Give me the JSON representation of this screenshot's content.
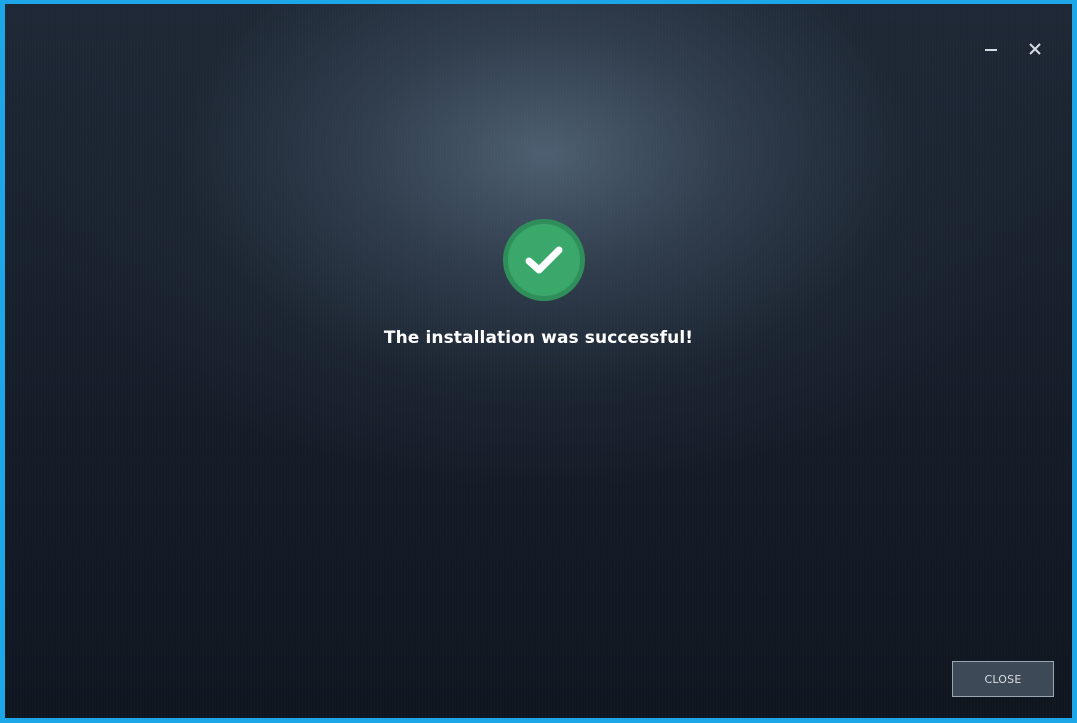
{
  "window": {
    "controls": {
      "minimize_icon": "minimize-icon",
      "close_icon": "close-icon"
    }
  },
  "status": {
    "icon": "checkmark-circle-icon",
    "message": "The installation was successful!"
  },
  "footer": {
    "close_label": "CLOSE"
  },
  "colors": {
    "frame_border": "#1ea7e8",
    "background_dark": "#151d29",
    "success_green": "#3aa86b",
    "text": "#ffffff"
  }
}
